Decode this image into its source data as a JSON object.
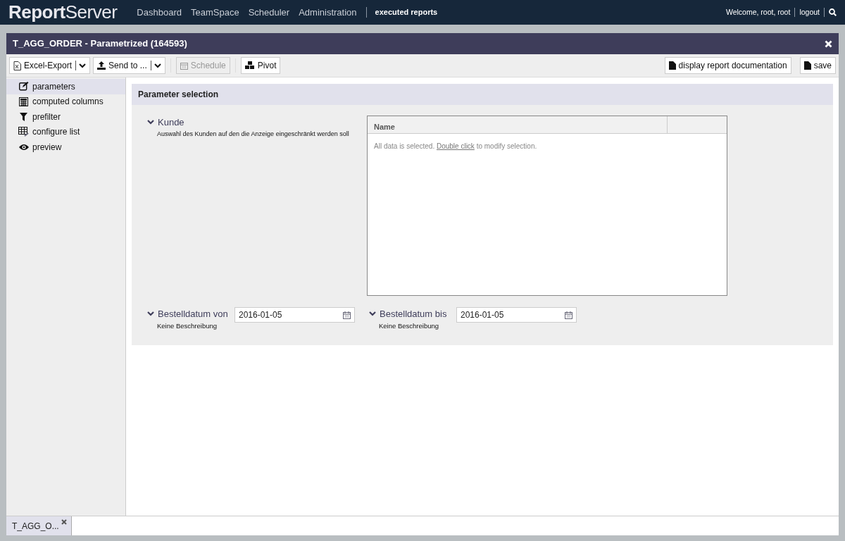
{
  "app": {
    "logo": "**Report**Server",
    "nav": [
      {
        "label": "Dashboard"
      },
      {
        "label": "TeamSpace"
      },
      {
        "label": "Scheduler"
      },
      {
        "label": "Administration"
      }
    ],
    "nav_extra": "executed reports",
    "welcome": "Welcome, root, root",
    "logout": "logout"
  },
  "window": {
    "title": "T_AGG_ORDER - Parametrized (164593)",
    "toolbar_left": [
      {
        "label": "Excel-Export",
        "kind": "split",
        "disabled": false
      },
      {
        "label": "Send to ...",
        "kind": "split",
        "disabled": false
      },
      {
        "label": "Schedule",
        "kind": "plain",
        "disabled": true
      },
      {
        "label": "Pivot",
        "kind": "plain",
        "disabled": false
      }
    ],
    "toolbar_right": [
      {
        "label": "display report documentation"
      },
      {
        "label": "save"
      }
    ]
  },
  "sidebar": {
    "items": [
      {
        "label": "parameters",
        "selected": true
      },
      {
        "label": "computed columns",
        "selected": false
      },
      {
        "label": "prefilter",
        "selected": false
      },
      {
        "label": "configure list",
        "selected": false
      },
      {
        "label": "preview",
        "selected": false
      }
    ]
  },
  "panel": {
    "title": "Parameter selection",
    "parameters": [
      {
        "kind": "list",
        "name": "Kunde",
        "description": "Auswahl des Kunden auf den die Anzeige eingeschränkt werden soll",
        "columns": [
          "Name"
        ],
        "message_before": "All data is selected. ",
        "message_link": "Double click",
        "message_after": " to modify selection."
      },
      {
        "kind": "date",
        "name": "Bestelldatum von",
        "description": "Keine Beschreibung",
        "value": "2016-01-05"
      },
      {
        "kind": "date",
        "name": "Bestelldatum bis",
        "description": "Keine Beschreibung",
        "value": "2016-01-05"
      }
    ]
  },
  "bottom_tabs": [
    {
      "label": "T_AGG_O...",
      "selected": true
    }
  ]
}
